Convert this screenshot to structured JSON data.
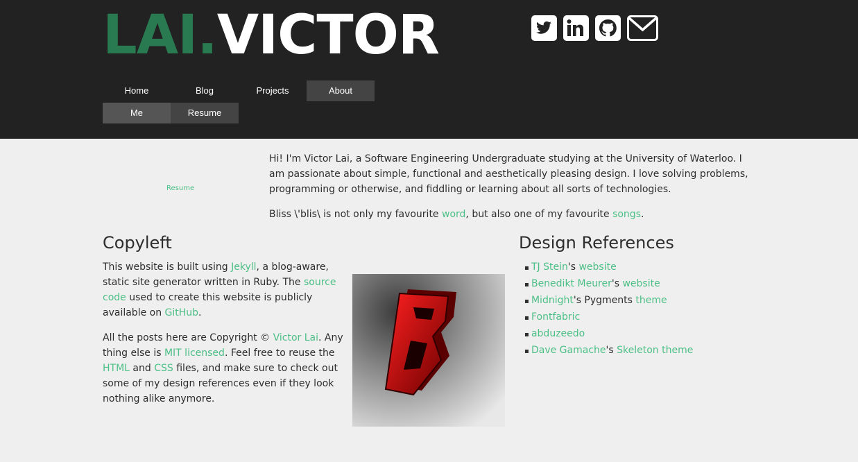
{
  "logo": {
    "part1": "LAI.",
    "part2": "VICTOR"
  },
  "social": {
    "icons": [
      "twitter-icon",
      "linkedin-icon",
      "github-icon",
      "mail-icon"
    ]
  },
  "nav": {
    "items": [
      "Home",
      "Blog",
      "Projects",
      "About"
    ],
    "active": "About"
  },
  "subnav": {
    "items": [
      "Me",
      "Resume"
    ]
  },
  "sidebar": {
    "resume_link": "Resume"
  },
  "intro": {
    "p1": "Hi! I'm Victor Lai, a Software Engineering Undergraduate studying at the University of Waterloo. I am passionate about simple, functional and aesthetically pleasing design. I love solving problems, programming or otherwise, and fiddling or learning about all sorts of technologies.",
    "p2_a": "Bliss \\'blis\\ is not only my favourite ",
    "p2_link1": "word",
    "p2_b": ", but also one of my favourite ",
    "p2_link2": "songs",
    "p2_c": "."
  },
  "copyleft": {
    "title": "Copyleft",
    "p1_a": "This website is built using ",
    "p1_link1": "Jekyll",
    "p1_b": ", a blog-aware, static site generator written in Ruby. The ",
    "p1_link2": "source code",
    "p1_c": " used to create this website is publicly available on ",
    "p1_link3": "GitHub",
    "p1_d": ".",
    "p2_a": "All the posts here are Copyright © ",
    "p2_link1": "Victor Lai",
    "p2_b": ". Any thing else is ",
    "p2_link2": "MIT licensed",
    "p2_c": ". Feel free to reuse the ",
    "p2_link3": "HTML",
    "p2_d": " and ",
    "p2_link4": "CSS",
    "p2_e": " files, and make sure to check out some of my design references even if they look nothing alike anymore."
  },
  "references": {
    "title": "Design References",
    "items": [
      {
        "link1": "TJ Stein",
        "text": "'s ",
        "link2": "website"
      },
      {
        "link1": "Benedikt Meurer",
        "text": "'s ",
        "link2": "website"
      },
      {
        "link1": "Midnight",
        "text": "'s Pygments ",
        "link2": "theme"
      },
      {
        "link1": "Fontfabric",
        "text": "",
        "link2": ""
      },
      {
        "link1": "abduzeedo",
        "text": "",
        "link2": ""
      },
      {
        "link1": "Dave Gamache",
        "text": "'s ",
        "link2": "Skeleton theme"
      }
    ]
  },
  "colors": {
    "header_bg": "#222222",
    "accent": "#4cbf86",
    "logo_green": "#2a7a51",
    "page_bg": "#efefef"
  }
}
